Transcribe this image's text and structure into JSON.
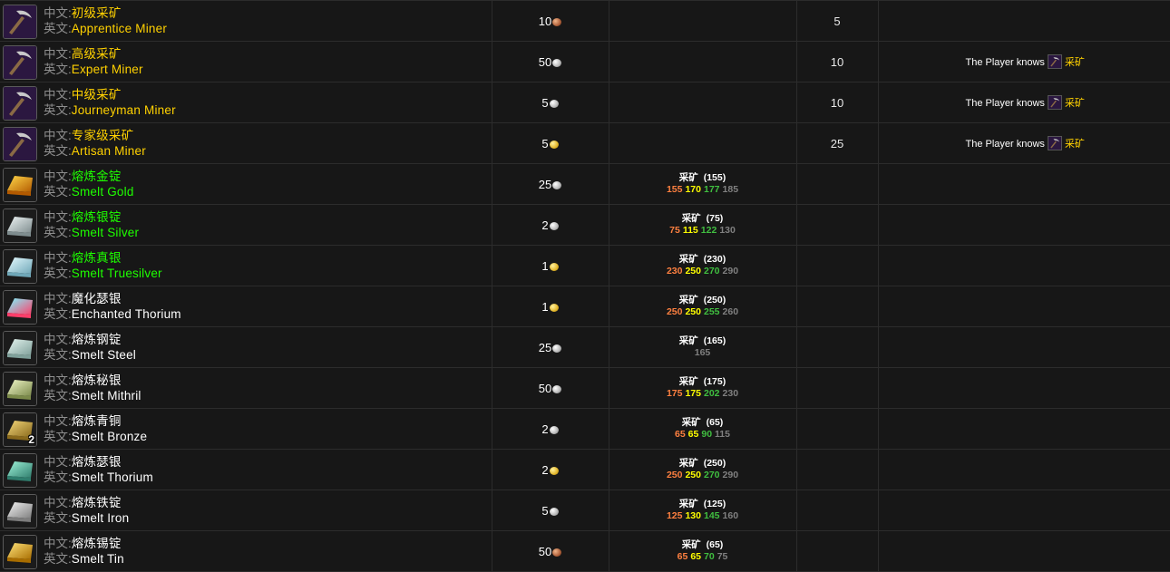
{
  "labels": {
    "cn": "中文:",
    "en": "英文:"
  },
  "rows": [
    {
      "icon": "pickaxe-icon",
      "cn": "初级采矿",
      "en": "Apprentice Miner",
      "quality": "orange",
      "cost": "10",
      "coin": "copper",
      "skill": "",
      "skill_req": "",
      "levels": [],
      "level": "5",
      "req_prefix": "",
      "req_spell": ""
    },
    {
      "icon": "pickaxe-icon",
      "cn": "高级采矿",
      "en": "Expert Miner",
      "quality": "orange",
      "cost": "50",
      "coin": "silver",
      "skill": "",
      "skill_req": "",
      "levels": [],
      "level": "10",
      "req_prefix": "The Player knows",
      "req_spell": "采矿"
    },
    {
      "icon": "pickaxe-icon",
      "cn": "中级采矿",
      "en": "Journeyman Miner",
      "quality": "orange",
      "cost": "5",
      "coin": "silver",
      "skill": "",
      "skill_req": "",
      "levels": [],
      "level": "10",
      "req_prefix": "The Player knows",
      "req_spell": "采矿"
    },
    {
      "icon": "pickaxe-icon",
      "cn": "专家级采矿",
      "en": "Artisan Miner",
      "quality": "orange",
      "cost": "5",
      "coin": "gold",
      "skill": "",
      "skill_req": "",
      "levels": [],
      "level": "25",
      "req_prefix": "The Player knows",
      "req_spell": "采矿"
    },
    {
      "icon": "gold-bar-icon",
      "cn": "熔炼金锭",
      "en": "Smelt Gold",
      "quality": "green",
      "cost": "25",
      "coin": "silver",
      "skill": "采矿",
      "skill_req": "(155)",
      "levels": [
        "155",
        "170",
        "177",
        "185"
      ],
      "level": "",
      "req_prefix": "",
      "req_spell": ""
    },
    {
      "icon": "silver-bar-icon",
      "cn": "熔炼银锭",
      "en": "Smelt Silver",
      "quality": "green",
      "cost": "2",
      "coin": "silver",
      "skill": "采矿",
      "skill_req": "(75)",
      "levels": [
        "75",
        "115",
        "122",
        "130"
      ],
      "level": "",
      "req_prefix": "",
      "req_spell": ""
    },
    {
      "icon": "truesilver-bar-icon",
      "cn": "熔炼真银",
      "en": "Smelt Truesilver",
      "quality": "green",
      "cost": "1",
      "coin": "gold",
      "skill": "采矿",
      "skill_req": "(230)",
      "levels": [
        "230",
        "250",
        "270",
        "290"
      ],
      "level": "",
      "req_prefix": "",
      "req_spell": ""
    },
    {
      "icon": "enchanted-thorium-bar-icon",
      "cn": "魔化瑟银",
      "en": "Enchanted Thorium",
      "quality": "white",
      "cost": "1",
      "coin": "gold",
      "skill": "采矿",
      "skill_req": "(250)",
      "levels": [
        "250",
        "250",
        "255",
        "260"
      ],
      "level": "",
      "req_prefix": "",
      "req_spell": ""
    },
    {
      "icon": "steel-bar-icon",
      "cn": "熔炼钢锭",
      "en": "Smelt Steel",
      "quality": "white",
      "cost": "25",
      "coin": "silver",
      "skill": "采矿",
      "skill_req": "(165)",
      "levels": [
        "",
        "",
        "",
        "165"
      ],
      "level": "",
      "req_prefix": "",
      "req_spell": ""
    },
    {
      "icon": "mithril-bar-icon",
      "cn": "熔炼秘银",
      "en": "Smelt Mithril",
      "quality": "white",
      "cost": "50",
      "coin": "silver",
      "skill": "采矿",
      "skill_req": "(175)",
      "levels": [
        "175",
        "175",
        "202",
        "230"
      ],
      "level": "",
      "req_prefix": "",
      "req_spell": ""
    },
    {
      "icon": "bronze-bar-icon",
      "cn": "熔炼青铜",
      "en": "Smelt Bronze",
      "quality": "white",
      "cost": "2",
      "coin": "silver",
      "skill": "采矿",
      "skill_req": "(65)",
      "levels": [
        "65",
        "65",
        "90",
        "115"
      ],
      "level": "",
      "req_prefix": "",
      "req_spell": "",
      "stack": "2"
    },
    {
      "icon": "thorium-bar-icon",
      "cn": "熔炼瑟银",
      "en": "Smelt Thorium",
      "quality": "white",
      "cost": "2",
      "coin": "gold",
      "skill": "采矿",
      "skill_req": "(250)",
      "levels": [
        "250",
        "250",
        "270",
        "290"
      ],
      "level": "",
      "req_prefix": "",
      "req_spell": ""
    },
    {
      "icon": "iron-bar-icon",
      "cn": "熔炼铁锭",
      "en": "Smelt Iron",
      "quality": "white",
      "cost": "5",
      "coin": "silver",
      "skill": "采矿",
      "skill_req": "(125)",
      "levels": [
        "125",
        "130",
        "145",
        "160"
      ],
      "level": "",
      "req_prefix": "",
      "req_spell": ""
    },
    {
      "icon": "tin-bar-icon",
      "cn": "熔炼锡锭",
      "en": "Smelt Tin",
      "quality": "white",
      "cost": "50",
      "coin": "copper",
      "skill": "采矿",
      "skill_req": "(65)",
      "levels": [
        "65",
        "65",
        "70",
        "75"
      ],
      "level": "",
      "req_prefix": "",
      "req_spell": ""
    }
  ],
  "icon_colors": {
    "pickaxe-icon": [
      "#2b1740",
      "#c9c9c9"
    ],
    "gold-bar-icon": [
      "#b35a00",
      "#ffd84a"
    ],
    "silver-bar-icon": [
      "#7e8c8e",
      "#eef4f4"
    ],
    "truesilver-bar-icon": [
      "#6fa7b8",
      "#e6fbff"
    ],
    "enchanted-thorium-bar-icon": [
      "#ff3e6a",
      "#7cf7ff"
    ],
    "steel-bar-icon": [
      "#7fa09a",
      "#e6f5f0"
    ],
    "mithril-bar-icon": [
      "#7b8a4a",
      "#f1f7c9"
    ],
    "bronze-bar-icon": [
      "#8a6a1c",
      "#f3d679"
    ],
    "thorium-bar-icon": [
      "#2f7d6d",
      "#9ff3d9"
    ],
    "iron-bar-icon": [
      "#7d7d7d",
      "#f2f2f2"
    ],
    "tin-bar-icon": [
      "#a86d00",
      "#ffe37a"
    ]
  }
}
